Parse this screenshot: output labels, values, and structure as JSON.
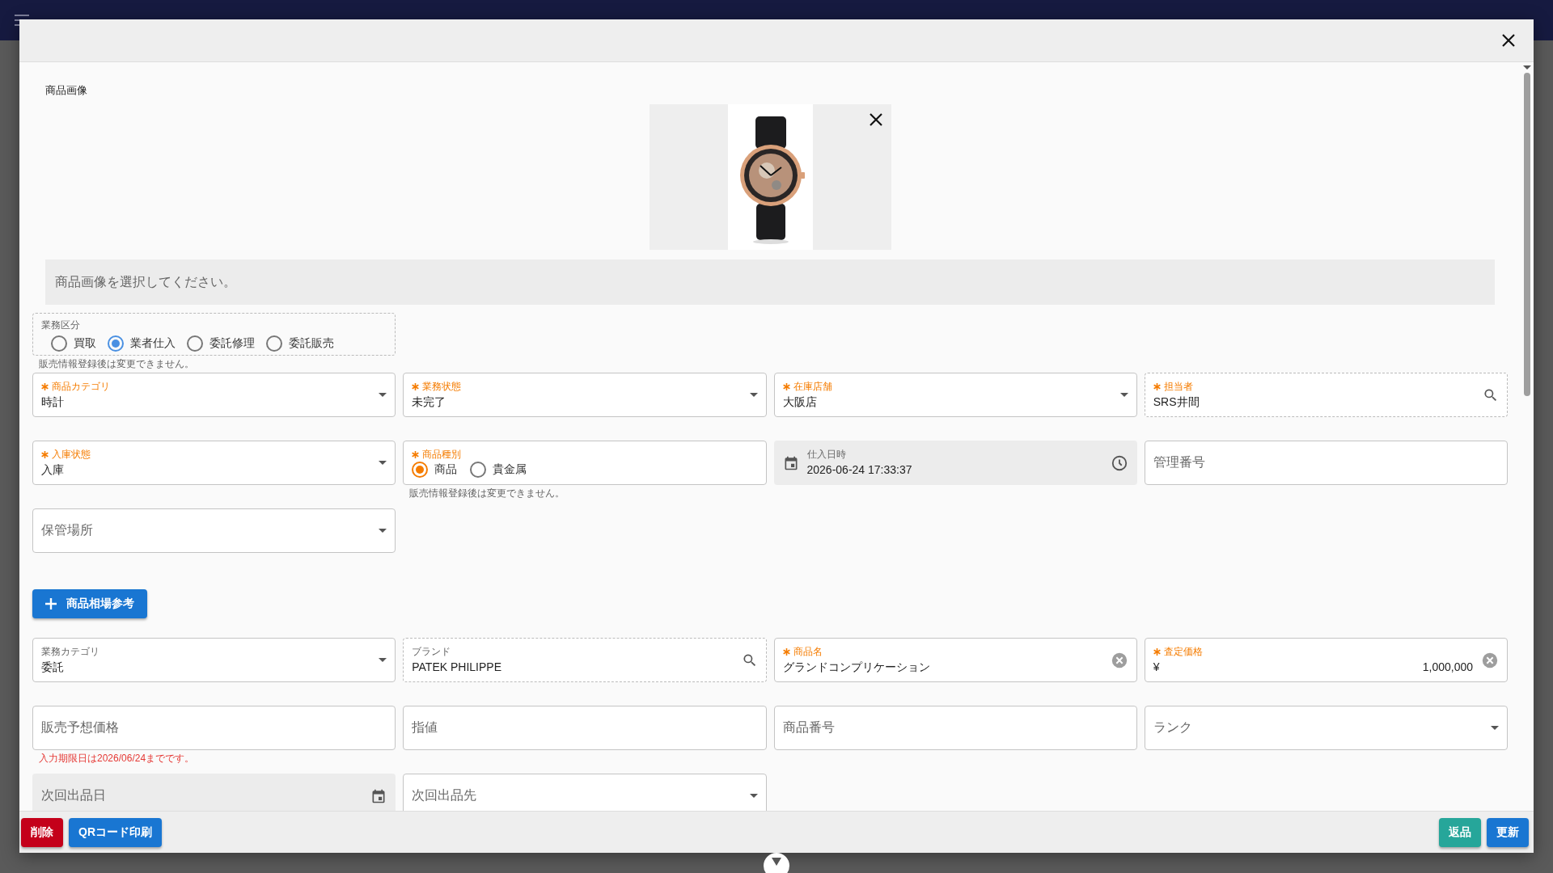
{
  "image_section": {
    "label": "商品画像",
    "dropzone_text": "商品画像を選択してください。"
  },
  "business_type": {
    "label": "業務区分",
    "readonly": true,
    "helper": "販売情報登録後は変更できません。",
    "options": [
      {
        "label": "買取",
        "selected": false
      },
      {
        "label": "業者仕入",
        "selected": true
      },
      {
        "label": "委託修理",
        "selected": false
      },
      {
        "label": "委託販売",
        "selected": false
      }
    ]
  },
  "fields_top": [
    {
      "kind": "select",
      "label": "商品カテゴリ",
      "required": true,
      "value": "時計"
    },
    {
      "kind": "select",
      "label": "業務状態",
      "required": true,
      "value": "未完了"
    },
    {
      "kind": "select",
      "label": "在庫店舗",
      "required": true,
      "value": "大阪店"
    },
    {
      "kind": "search",
      "label": "担当者",
      "required": true,
      "readonly": true,
      "value": "SRS井間"
    },
    {
      "kind": "select",
      "label": "入庫状態",
      "required": true,
      "value": "入庫"
    },
    {
      "kind": "radio",
      "label": "商品種別",
      "required": true,
      "helper": "販売情報登録後は変更できません。",
      "options": [
        {
          "label": "商品",
          "selected": true
        },
        {
          "label": "貴金属",
          "selected": false
        }
      ]
    },
    {
      "kind": "datetime",
      "label": "仕入日時",
      "required": false,
      "disabled": true,
      "value": "2026-06-24 17:33:37"
    },
    {
      "kind": "text",
      "placeholder": "管理番号"
    },
    {
      "kind": "select",
      "placeholder": "保管場所"
    }
  ],
  "market_button": {
    "label": "商品相場参考"
  },
  "fields_bottom": [
    {
      "kind": "select",
      "label": "業務カテゴリ",
      "required": false,
      "value": "委託"
    },
    {
      "kind": "search",
      "label": "ブランド",
      "required": false,
      "readonly": true,
      "value": "PATEK PHILIPPE"
    },
    {
      "kind": "clearable",
      "label": "商品名",
      "required": true,
      "value": "グランドコンプリケーション"
    },
    {
      "kind": "currency",
      "label": "査定価格",
      "required": true,
      "prefix": "¥",
      "value": "1,000,000"
    },
    {
      "kind": "text",
      "placeholder": "販売予想価格",
      "error": "入力期限日は2026/06/24までです。"
    },
    {
      "kind": "text",
      "placeholder": "指値"
    },
    {
      "kind": "text",
      "placeholder": "商品番号"
    },
    {
      "kind": "select",
      "placeholder": "ランク"
    },
    {
      "kind": "date",
      "placeholder": "次回出品日",
      "disabled": true
    },
    {
      "kind": "select",
      "placeholder": "次回出品先"
    }
  ],
  "footer": {
    "left": [
      {
        "label": "削除",
        "color": "#c4001a"
      },
      {
        "label": "QRコード印刷",
        "color": "#1976d2"
      }
    ],
    "right": [
      {
        "label": "返品",
        "color": "#26a69a"
      },
      {
        "label": "更新",
        "color": "#1976d2"
      }
    ]
  }
}
